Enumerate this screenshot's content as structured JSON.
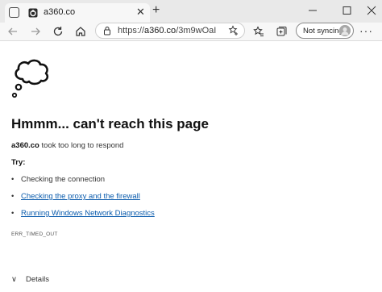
{
  "tab": {
    "title": "a360.co",
    "close_glyph": "✕"
  },
  "new_tab_glyph": "+",
  "address": {
    "prefix": "https://",
    "host": "a360.co",
    "path": "/3m9wOaI"
  },
  "profile": {
    "sync_label": "Not syncing"
  },
  "more_glyph": "···",
  "error": {
    "heading": "Hmmm... can't reach this page",
    "site": "a360.co",
    "reason": "took too long to respond",
    "try_label": "Try:",
    "suggestions": [
      {
        "text": "Checking the connection",
        "link": false
      },
      {
        "text": "Checking the proxy and the firewall",
        "link": true
      },
      {
        "text": "Running Windows Network Diagnostics",
        "link": true
      }
    ],
    "code": "ERR_TIMED_OUT",
    "details_label": "Details",
    "bullet": "•",
    "details_chevron": "∨"
  },
  "colors": {
    "link": "#0b5cad",
    "titlebar": "#e9e9e9",
    "toolbar": "#f7f7f7"
  },
  "icons": [
    "tab-actions-icon",
    "favicon",
    "back-arrow-icon",
    "forward-arrow-icon",
    "refresh-icon",
    "home-icon",
    "lock-icon",
    "favorite-star-icon",
    "favorites-icon",
    "collections-icon",
    "avatar",
    "minimize-icon",
    "maximize-icon",
    "close-window-icon",
    "thought-cloud-icon"
  ]
}
